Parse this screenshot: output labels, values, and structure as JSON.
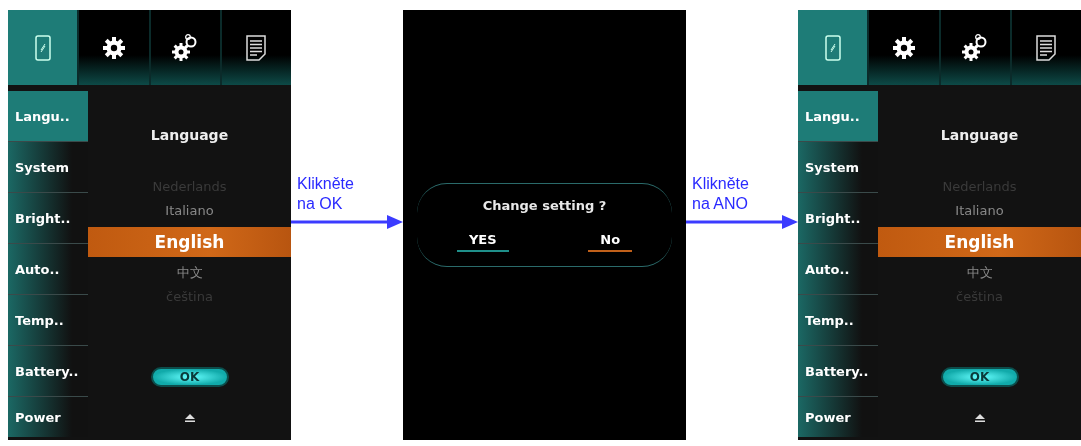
{
  "panels": [
    {
      "kind": "settings",
      "tabs": [
        {
          "selected": true
        },
        {
          "selected": false
        },
        {
          "selected": false
        },
        {
          "selected": false
        }
      ],
      "sidebar": [
        {
          "label": "Langu..",
          "selected": true
        },
        {
          "label": "System",
          "selected": false
        },
        {
          "label": "Bright..",
          "selected": false
        },
        {
          "label": "Auto..",
          "selected": false
        },
        {
          "label": "Temp..",
          "selected": false
        },
        {
          "label": "Battery..",
          "selected": false
        },
        {
          "label": "Power",
          "selected": false
        }
      ],
      "heading": "Language",
      "options": [
        {
          "label": "Nederlands",
          "selected": false,
          "faded": true
        },
        {
          "label": "Italiano",
          "selected": false,
          "faded": false
        },
        {
          "label": "English",
          "selected": true,
          "faded": false
        },
        {
          "label": "中文",
          "selected": false,
          "faded": false
        },
        {
          "label": "čeština",
          "selected": false,
          "faded": true
        }
      ],
      "ok_button": "OK"
    },
    {
      "kind": "annotation",
      "text": "Klikněte\nna OK"
    },
    {
      "kind": "dialog",
      "message": "Change setting ?",
      "buttons": [
        {
          "label": "YES",
          "color": "#1f8f8a"
        },
        {
          "label": "No",
          "color": "#c0601a"
        }
      ]
    },
    {
      "kind": "annotation",
      "text": "Klikněte\nna ANO"
    },
    {
      "kind": "settings",
      "tabs": [
        {
          "selected": true
        },
        {
          "selected": false
        },
        {
          "selected": false
        },
        {
          "selected": false
        }
      ],
      "sidebar": [
        {
          "label": "Langu..",
          "selected": true
        },
        {
          "label": "System",
          "selected": false
        },
        {
          "label": "Bright..",
          "selected": false
        },
        {
          "label": "Auto..",
          "selected": false
        },
        {
          "label": "Temp..",
          "selected": false
        },
        {
          "label": "Battery..",
          "selected": false
        },
        {
          "label": "Power",
          "selected": false
        }
      ],
      "heading": "Language",
      "options": [
        {
          "label": "Nederlands",
          "selected": false,
          "faded": true
        },
        {
          "label": "Italiano",
          "selected": false,
          "faded": false
        },
        {
          "label": "English",
          "selected": true,
          "faded": false
        },
        {
          "label": "中文",
          "selected": false,
          "faded": false
        },
        {
          "label": "čeština",
          "selected": false,
          "faded": true
        }
      ],
      "ok_button": "OK"
    }
  ]
}
